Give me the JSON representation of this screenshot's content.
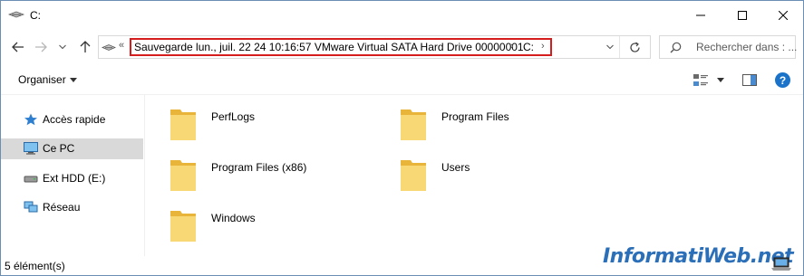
{
  "window": {
    "title": "C:"
  },
  "nav": {
    "breadcrumbs": [
      "Sauvegarde lun., juil. 22 24 10:16:57 VMware Virtual SATA Hard Drive 00000001",
      "C:"
    ],
    "overflow_chevron": "«",
    "separator": "›",
    "search_placeholder": "Rechercher dans : ..."
  },
  "toolbar": {
    "organise_label": "Organiser",
    "help_label": "?"
  },
  "sidebar": {
    "items": [
      {
        "label": "Accès rapide",
        "icon": "star-icon"
      },
      {
        "label": "Ce PC",
        "icon": "computer-icon",
        "selected": true
      },
      {
        "label": "Ext HDD (E:)",
        "icon": "drive-icon"
      },
      {
        "label": "Réseau",
        "icon": "network-icon"
      }
    ]
  },
  "content": {
    "items": [
      {
        "label": "PerfLogs",
        "icon": "folder-icon"
      },
      {
        "label": "Program Files",
        "icon": "folder-icon"
      },
      {
        "label": "Program Files (x86)",
        "icon": "folder-icon"
      },
      {
        "label": "Users",
        "icon": "folder-icon"
      },
      {
        "label": "Windows",
        "icon": "folder-icon"
      }
    ]
  },
  "status": {
    "count": "5 élément(s)"
  },
  "watermark": {
    "text": "InformatiWeb.net"
  },
  "colors": {
    "highlight_border": "#d61d1d",
    "selection": "#d9d9d9",
    "folder": "#f5c94c",
    "help_blue": "#1a73c9"
  }
}
